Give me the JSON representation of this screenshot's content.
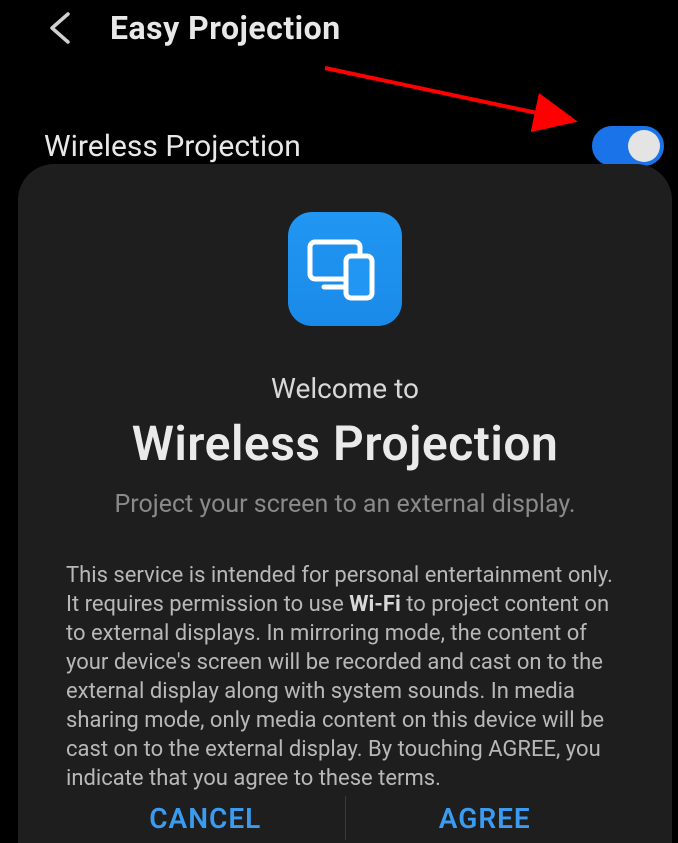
{
  "header": {
    "title": "Easy Projection"
  },
  "setting": {
    "label": "Wireless Projection",
    "toggle_state": "on"
  },
  "dialog": {
    "icon_name": "projection-icon",
    "welcome": "Welcome to",
    "title": "Wireless Projection",
    "subtitle": "Project your screen to an external display.",
    "terms_before": "This service is intended for personal entertainment only. It requires permission to use ",
    "terms_bold": "Wi-Fi",
    "terms_after": " to project content on to external displays. In mirroring mode, the content of your device's screen will be recorded and cast on to the external display along with system sounds. In media sharing mode, only media content on this device will be cast on to the external display. By touching AGREE, you indicate that you agree to these terms.",
    "cancel_label": "CANCEL",
    "agree_label": "AGREE"
  },
  "colors": {
    "accent": "#1a73e8",
    "dialog_bg": "#1e1e1e",
    "arrow": "#ff0000"
  }
}
